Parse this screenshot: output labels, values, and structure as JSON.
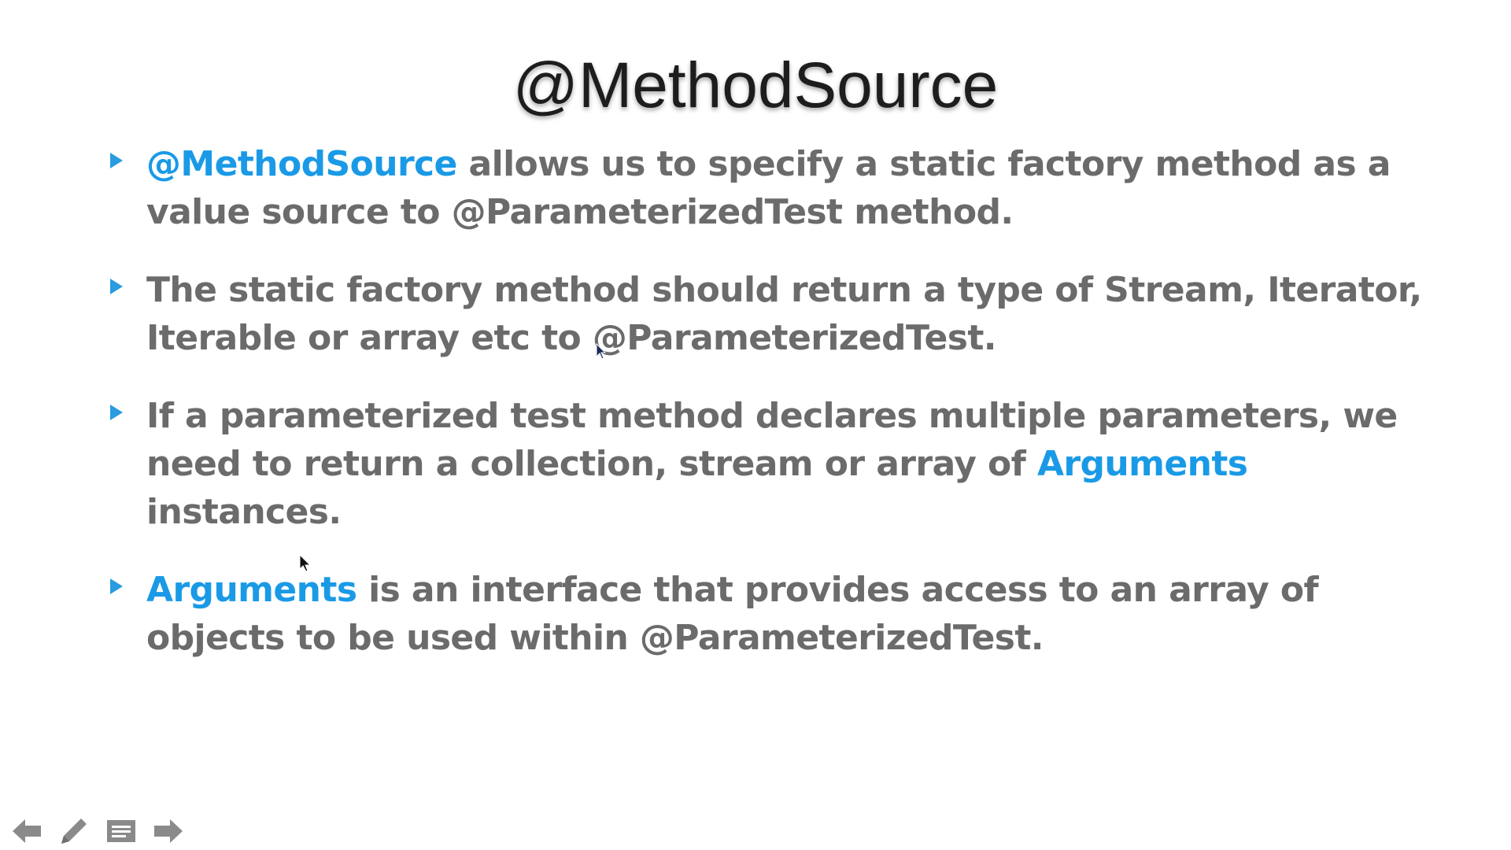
{
  "slide": {
    "title": "@MethodSource",
    "bullets": [
      {
        "parts": [
          {
            "text": "@MethodSource",
            "highlight": true
          },
          {
            "text": " allows us to specify a static factory method as a value source to @ParameterizedTest method.",
            "highlight": false
          }
        ]
      },
      {
        "parts": [
          {
            "text": "The static factory method should return a type of Stream, Iterator, Iterable or array etc to @ParameterizedTest.",
            "highlight": false
          }
        ]
      },
      {
        "parts": [
          {
            "text": "If a parameterized test method declares multiple parameters, we need to return a collection, stream or array of ",
            "highlight": false
          },
          {
            "text": "Arguments",
            "highlight": true
          },
          {
            "text": " instances.",
            "highlight": false
          }
        ]
      },
      {
        "parts": [
          {
            "text": "Arguments",
            "highlight": true
          },
          {
            "text": " is an interface that provides access to an array of objects to be used within @ParameterizedTest.",
            "highlight": false
          }
        ]
      }
    ]
  },
  "toolbar": {
    "items": [
      {
        "name": "previous-slide-button",
        "icon": "arrow-left-icon"
      },
      {
        "name": "pen-tool-button",
        "icon": "pencil-icon"
      },
      {
        "name": "slide-menu-button",
        "icon": "menu-icon"
      },
      {
        "name": "next-slide-button",
        "icon": "arrow-right-icon"
      }
    ]
  },
  "colors": {
    "accent": "#1a9ae6",
    "body_text": "#6b6b6b",
    "title_text": "#1d1d1d",
    "toolbar_icon": "#8a8a8a"
  }
}
